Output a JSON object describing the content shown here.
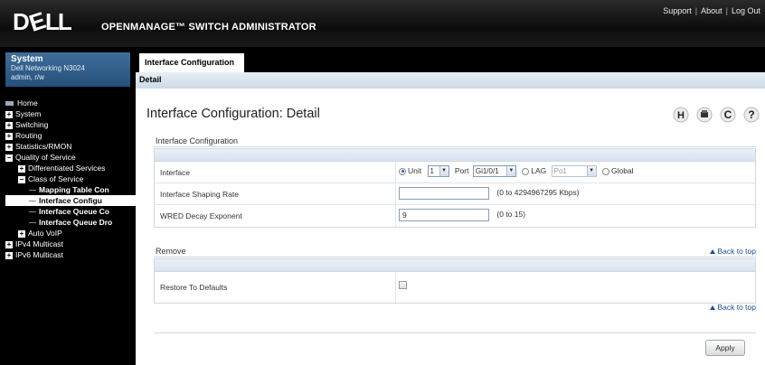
{
  "header": {
    "logo_text": "DELL",
    "app_title": "OPENMANAGE™ SWITCH ADMINISTRATOR",
    "links": [
      "Support",
      "About",
      "Log Out"
    ]
  },
  "sidebar": {
    "system_title": "System",
    "device": "Dell Networking N3024",
    "user": "admin, r/w",
    "nav": [
      {
        "label": "Home",
        "icon": "home-icon"
      },
      {
        "label": "System",
        "icon": "expand-icon"
      },
      {
        "label": "Switching",
        "icon": "expand-icon"
      },
      {
        "label": "Routing",
        "icon": "expand-icon"
      },
      {
        "label": "Statistics/RMON",
        "icon": "expand-icon"
      },
      {
        "label": "Quality of Service",
        "icon": "collapse-icon"
      },
      {
        "label": "Differentiated Services",
        "icon": "expand-icon"
      },
      {
        "label": "Class of Service",
        "icon": "collapse-icon"
      },
      {
        "label": "Mapping Table Con",
        "icon": "tree-line"
      },
      {
        "label": "Interface Configu",
        "icon": "tree-line"
      },
      {
        "label": "Interface Queue Co",
        "icon": "tree-line"
      },
      {
        "label": "Interface Queue Dro",
        "icon": "tree-line"
      },
      {
        "label": "Auto VoIP",
        "icon": "expand-icon"
      },
      {
        "label": "IPv4 Multicast",
        "icon": "expand-icon"
      },
      {
        "label": "IPv6 Multicast",
        "icon": "expand-icon"
      }
    ]
  },
  "tabs": {
    "active": "Interface Configuration",
    "subtab": "Detail"
  },
  "page": {
    "title": "Interface Configuration: Detail",
    "icons": [
      "help-icon",
      "print-icon",
      "refresh-icon",
      "question-icon"
    ],
    "icon_glyphs": {
      "help": "H",
      "print": "▬",
      "refresh": "C",
      "question": "?"
    }
  },
  "config_section": {
    "label": "Interface Configuration",
    "rows": {
      "interface": {
        "label": "Interface",
        "unit_label": "Unit",
        "unit_value": "1",
        "port_label": "Port",
        "port_value": "Gi1/0/1",
        "lag_label": "LAG",
        "lag_value": "Po1",
        "global_label": "Global",
        "selected": "Unit"
      },
      "shaping": {
        "label": "Interface Shaping Rate",
        "value": "",
        "hint": "(0 to 4294967295 Kbps)"
      },
      "wred": {
        "label": "WRED Decay Exponent",
        "value": "9",
        "hint": "(0 to 15)"
      }
    }
  },
  "remove_section": {
    "label": "Remove",
    "back_to_top": "Back to top",
    "restore_label": "Restore To Defaults",
    "restore_checked": false
  },
  "bottom_back_to_top": "Back to top",
  "apply_label": "Apply",
  "colors": {
    "header_bg": "#111111",
    "system_box": "#2f5f8c",
    "link": "#1f4f8f"
  }
}
